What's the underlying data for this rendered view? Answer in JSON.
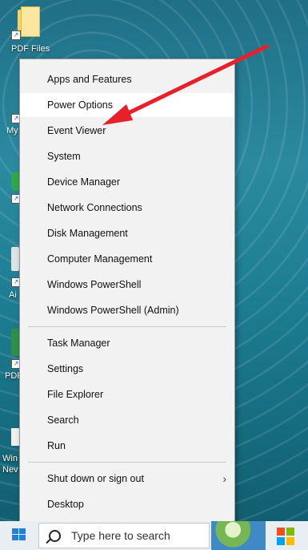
{
  "desktop": {
    "icons": [
      {
        "label": "PDF Files"
      },
      {
        "label": "My"
      },
      {
        "label": "Ai"
      },
      {
        "label": "PDF"
      },
      {
        "label": "Win"
      },
      {
        "label": "Nev"
      }
    ]
  },
  "menu": {
    "items": [
      {
        "label": "Apps and Features"
      },
      {
        "label": "Power Options"
      },
      {
        "label": "Event Viewer"
      },
      {
        "label": "System"
      },
      {
        "label": "Device Manager"
      },
      {
        "label": "Network Connections"
      },
      {
        "label": "Disk Management"
      },
      {
        "label": "Computer Management"
      },
      {
        "label": "Windows PowerShell"
      },
      {
        "label": "Windows PowerShell (Admin)"
      },
      {
        "label": "Task Manager"
      },
      {
        "label": "Settings"
      },
      {
        "label": "File Explorer"
      },
      {
        "label": "Search"
      },
      {
        "label": "Run"
      },
      {
        "label": "Shut down or sign out"
      },
      {
        "label": "Desktop"
      }
    ],
    "hovered_item": "Power Options",
    "submenu_chevron": "›"
  },
  "annotation": {
    "color": "#e8202a",
    "target": "Event Viewer"
  },
  "taskbar": {
    "search_placeholder": "Type here to search",
    "start_icon": "windows-logo-icon",
    "search_icon": "magnifier-icon"
  }
}
